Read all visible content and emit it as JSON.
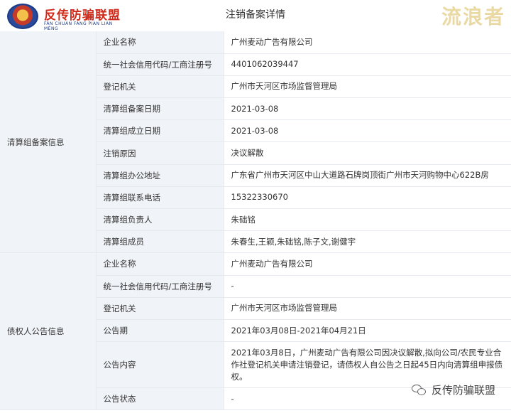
{
  "header": {
    "logo_title": "反传防骗联盟",
    "logo_sub": "FĂN CHUÁN FÁNG PIÀN LIÁN MÉNG",
    "page_title": "注销备案详情",
    "watermark": "流浪者"
  },
  "sections": [
    {
      "title": "清算组备案信息",
      "rows": [
        {
          "label": "企业名称",
          "value": "广州麦动广告有限公司"
        },
        {
          "label": "统一社会信用代码/工商注册号",
          "value": "4401062039447"
        },
        {
          "label": "登记机关",
          "value": "广州市天河区市场监督管理局"
        },
        {
          "label": "清算组备案日期",
          "value": "2021-03-08"
        },
        {
          "label": "清算组成立日期",
          "value": "2021-03-08"
        },
        {
          "label": "注销原因",
          "value": "决议解散"
        },
        {
          "label": "清算组办公地址",
          "value": "广东省广州市天河区中山大道路石牌岗顶街广州市天河购物中心622B房"
        },
        {
          "label": "清算组联系电话",
          "value": "15322330670"
        },
        {
          "label": "清算组负责人",
          "value": "朱础铭"
        },
        {
          "label": "清算组成员",
          "value": "朱春生,王颖,朱础铭,陈子文,谢健宇"
        }
      ]
    },
    {
      "title": "债权人公告信息",
      "rows": [
        {
          "label": "企业名称",
          "value": "广州麦动广告有限公司"
        },
        {
          "label": "统一社会信用代码/工商注册号",
          "value": "-"
        },
        {
          "label": "登记机关",
          "value": "广州市天河区市场监督管理局"
        },
        {
          "label": "公告期",
          "value": "2021年03月08日-2021年04月21日"
        },
        {
          "label": "公告内容",
          "value": "2021年03月8日，广州麦动广告有限公司因决议解散,拟向公司/农民专业合作社登记机关申请注销登记，请债权人自公告之日起45日内向清算组申报债权。"
        },
        {
          "label": "公告状态",
          "value": "-"
        }
      ]
    }
  ],
  "footer": {
    "brand": "反传防骗联盟"
  }
}
